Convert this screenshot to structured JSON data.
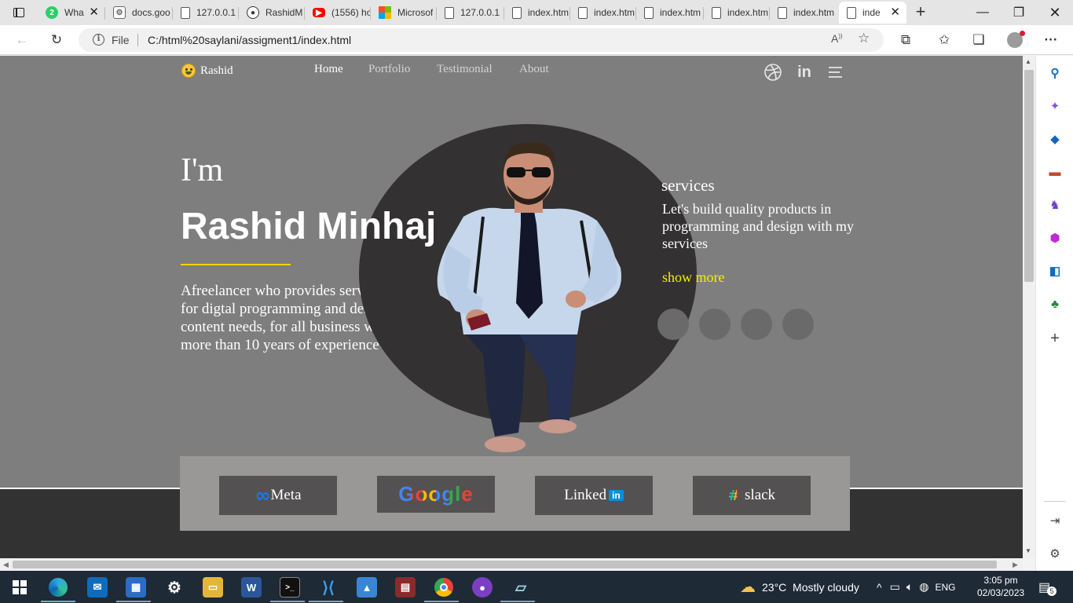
{
  "browser": {
    "tabs": [
      {
        "label": "Wha",
        "icon": "whatsapp-icon",
        "badge": "2",
        "has_close": true
      },
      {
        "label": "docs.goo",
        "icon": "google-docs-icon"
      },
      {
        "label": "127.0.0.1",
        "icon": "document-icon"
      },
      {
        "label": "RashidM",
        "icon": "github-icon"
      },
      {
        "label": "(1556) ho",
        "icon": "youtube-icon"
      },
      {
        "label": "Microsof",
        "icon": "microsoft-icon"
      },
      {
        "label": "127.0.0.1",
        "icon": "document-icon"
      },
      {
        "label": "index.htm",
        "icon": "document-icon"
      },
      {
        "label": "index.htm",
        "icon": "document-icon"
      },
      {
        "label": "index.htm",
        "icon": "document-icon"
      },
      {
        "label": "index.htm",
        "icon": "document-icon"
      },
      {
        "label": "index.htm",
        "icon": "document-icon"
      },
      {
        "label": "inde",
        "icon": "document-icon",
        "active": true
      }
    ],
    "address": {
      "scheme_label": "File",
      "url": "C:/html%20saylani/assigment1/index.html"
    }
  },
  "page": {
    "brand": "Rashid",
    "nav": [
      "Home",
      "Portfolio",
      "Testimonial",
      "About"
    ],
    "hero": {
      "greeting": "I'm",
      "name": "Rashid Minhaj",
      "intro": "Afreelancer who provides services for digtal programming and design content needs, for all business with more than 10 years of experience"
    },
    "services": {
      "title": "services",
      "text": "Let's build quality products in programming and design with my services",
      "link": "show more"
    },
    "companies": [
      "Meta",
      "Google",
      "Linked",
      "slack"
    ],
    "linkedin_badge": "in",
    "accent_color": "#f2f200",
    "background_color": "#7f7e7e"
  },
  "taskbar": {
    "weather": "23°C  Mostly cloudy",
    "language": "ENG",
    "time": "3:05 pm",
    "date": "02/03/2023",
    "notifications": "5"
  }
}
